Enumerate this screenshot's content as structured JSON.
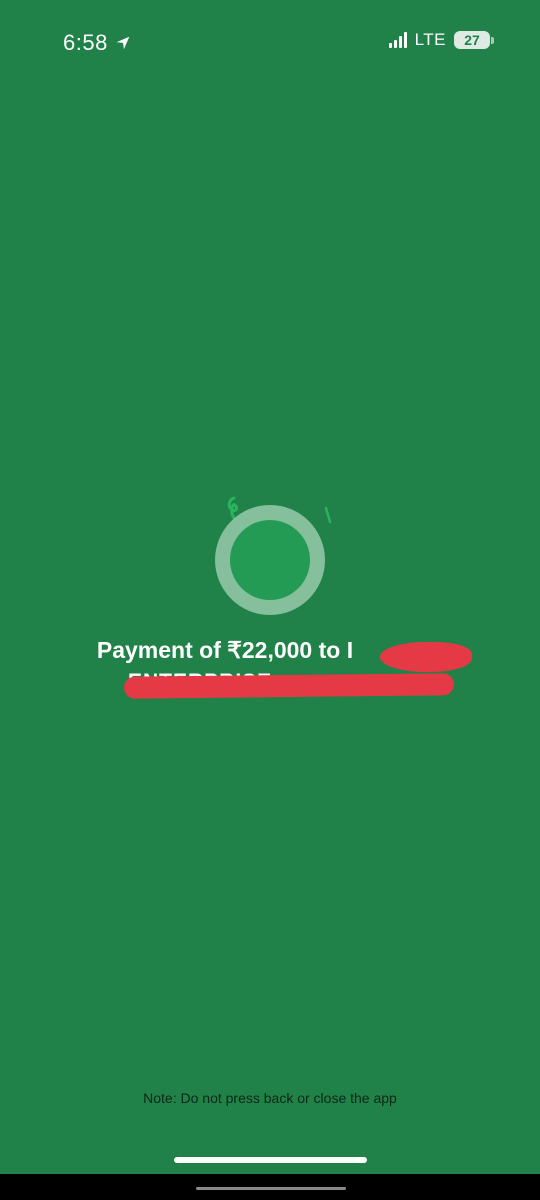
{
  "status_bar": {
    "time": "6:58",
    "network": "LTE",
    "battery": "27"
  },
  "payment": {
    "message": "Payment of ₹22,000 to I",
    "recipient_line": "ENTERPRISE"
  },
  "footer": {
    "note": "Note: Do not press back or close the app"
  },
  "colors": {
    "background": "#208249",
    "spinner_outer": "#86bf9b",
    "spinner_inner": "#249b55",
    "redaction": "#e63946"
  }
}
